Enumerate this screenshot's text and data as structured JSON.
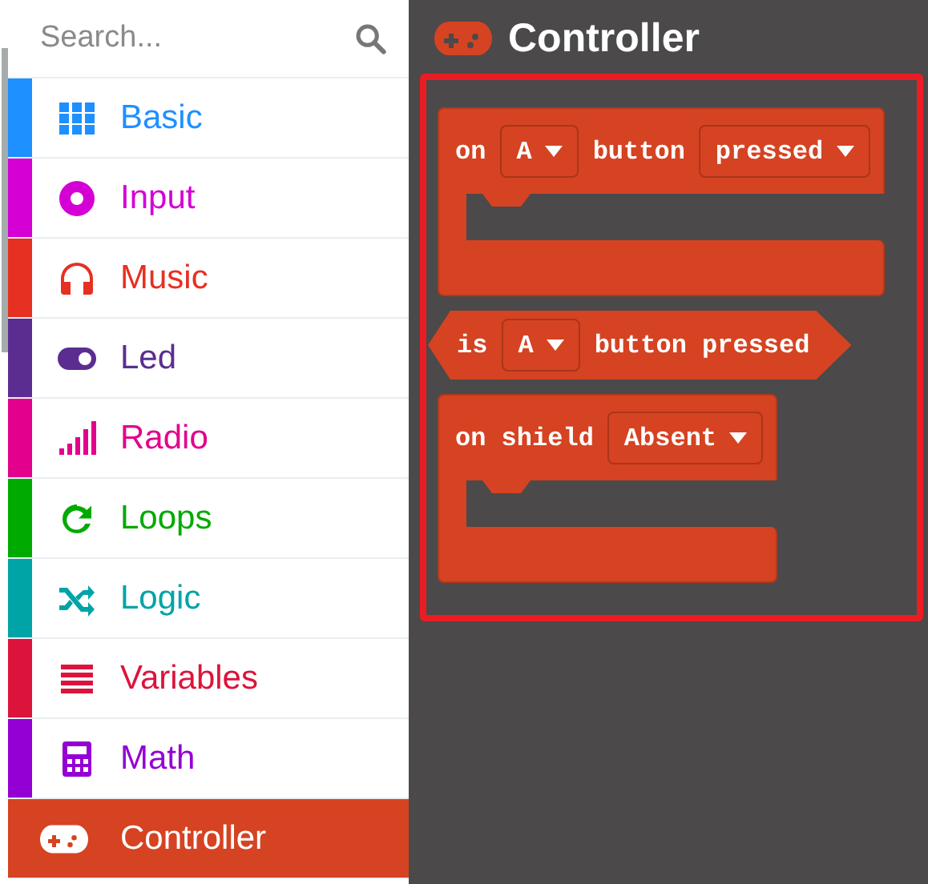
{
  "search": {
    "placeholder": "Search..."
  },
  "categories": [
    {
      "label": "Basic",
      "color": "#1e90ff",
      "selected": false
    },
    {
      "label": "Input",
      "color": "#d400d4",
      "selected": false
    },
    {
      "label": "Music",
      "color": "#e63022",
      "selected": false
    },
    {
      "label": "Led",
      "color": "#5c2d91",
      "selected": false
    },
    {
      "label": "Radio",
      "color": "#e3008c",
      "selected": false
    },
    {
      "label": "Loops",
      "color": "#00aa00",
      "selected": false
    },
    {
      "label": "Logic",
      "color": "#00a4a6",
      "selected": false
    },
    {
      "label": "Variables",
      "color": "#dc143c",
      "selected": false
    },
    {
      "label": "Math",
      "color": "#9400d3",
      "selected": false
    },
    {
      "label": "Controller",
      "color": "#d54322",
      "selected": true
    }
  ],
  "flyout": {
    "title": "Controller",
    "highlighted": true,
    "blocks": [
      {
        "kind": "event",
        "parts": [
          {
            "kind": "text",
            "text": "on"
          },
          {
            "kind": "dropdown",
            "text": "A"
          },
          {
            "kind": "text",
            "text": "button"
          },
          {
            "kind": "dropdown",
            "text": "pressed"
          }
        ]
      },
      {
        "kind": "boolean",
        "parts": [
          {
            "kind": "text",
            "text": "is"
          },
          {
            "kind": "dropdown",
            "text": "A"
          },
          {
            "kind": "text",
            "text": "button pressed"
          }
        ]
      },
      {
        "kind": "event",
        "parts": [
          {
            "kind": "text",
            "text": "on shield"
          },
          {
            "kind": "dropdown",
            "text": "Absent"
          }
        ]
      }
    ]
  }
}
